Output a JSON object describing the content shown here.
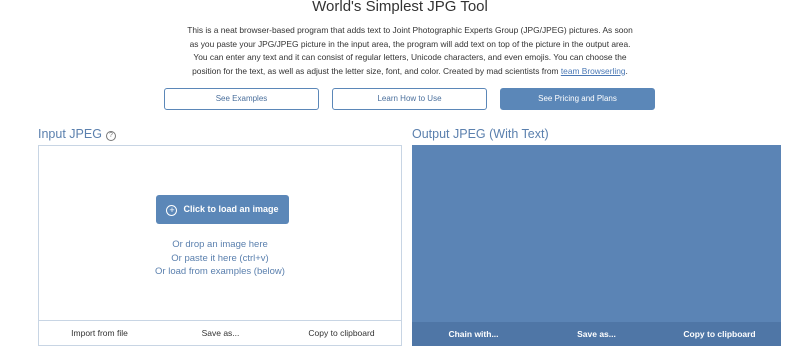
{
  "header": {
    "title": "World's Simplest JPG Tool",
    "intro_lines": [
      "This is a neat browser-based program that adds text to Joint Photographic Experts Group (JPG/JPEG) pictures. As soon",
      "as you paste your JPG/JPEG picture in the input area, the program will add text on top of the picture in the output area.",
      "You can enter any text and it can consist of regular letters, Unicode characters, and even emojis. You can choose the",
      "position for the text, as well as adjust the letter size, font, and color. Created by mad scientists from "
    ],
    "intro_link": "team Browserling",
    "intro_end": "."
  },
  "buttons": {
    "examples": "See Examples",
    "howto": "Learn How to Use",
    "pricing": "See Pricing and Plans"
  },
  "input_panel": {
    "title": "Input JPEG",
    "help_icon": "help-circle-icon",
    "load_button": "Click to load an image",
    "drop_lines": [
      "Or drop an image here",
      "Or paste it here (ctrl+v)",
      "Or load from examples (below)"
    ],
    "footer": {
      "import": "Import from file",
      "save": "Save as...",
      "copy": "Copy to clipboard"
    }
  },
  "output_panel": {
    "title": "Output JPEG (With Text)",
    "footer": {
      "chain": "Chain with...",
      "save": "Save as...",
      "copy": "Copy to clipboard"
    }
  },
  "colors": {
    "accent": "#5b87b8",
    "output_bg": "#5b84b5",
    "output_footer": "#4f76a6",
    "panel_title": "#5b80ae"
  }
}
